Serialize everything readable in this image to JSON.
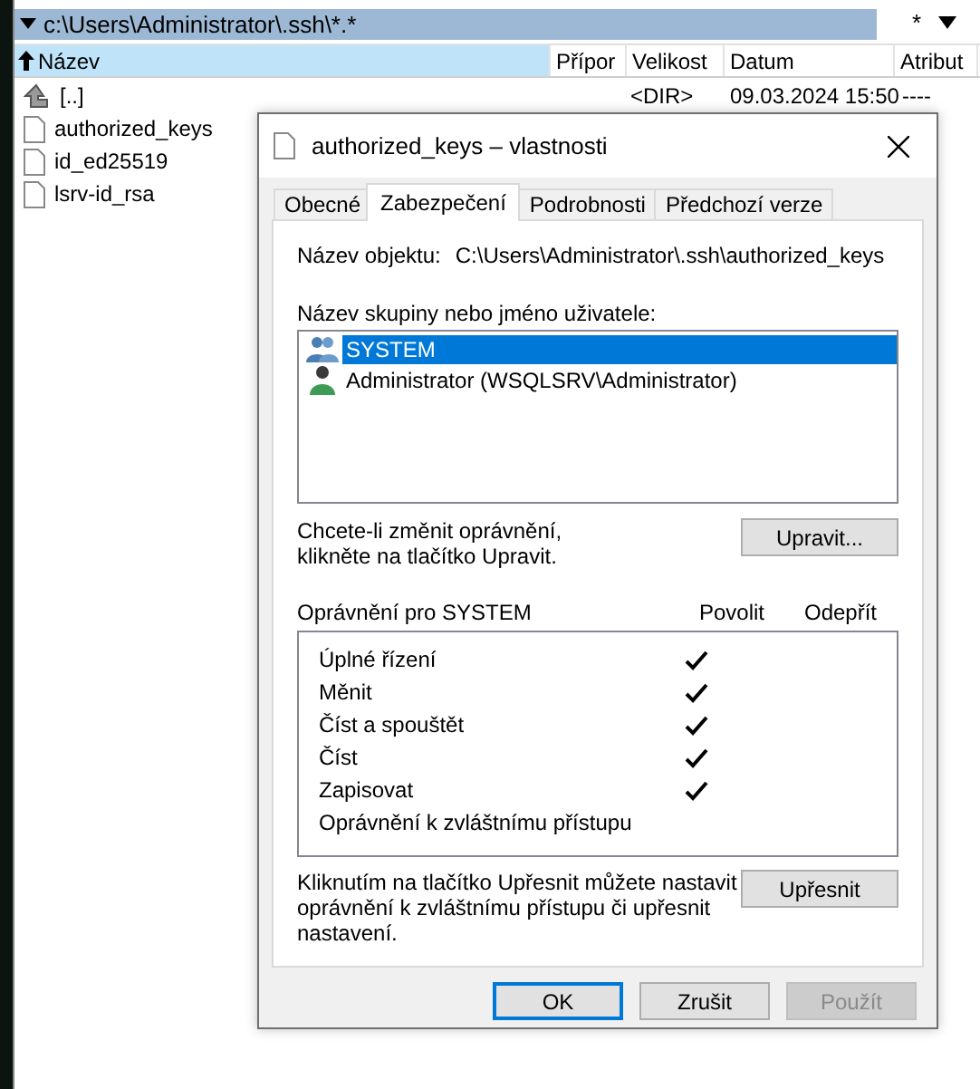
{
  "file_panel": {
    "path": "c:\\Users\\Administrator\\.ssh\\*.*",
    "filter_button": "*",
    "columns": [
      {
        "label": "Název",
        "sorted": true
      },
      {
        "label": "Přípor",
        "sorted": false
      },
      {
        "label": "Velikost",
        "sorted": false
      },
      {
        "label": "Datum",
        "sorted": false
      },
      {
        "label": "Atribut",
        "sorted": false
      }
    ],
    "rows": [
      {
        "kind": "parent",
        "name": "[..]",
        "size": "<DIR>",
        "date": "09.03.2024 15:50",
        "attributes": "----"
      },
      {
        "kind": "file",
        "name": "authorized_keys"
      },
      {
        "kind": "file",
        "name": "id_ed25519"
      },
      {
        "kind": "file",
        "name": "lsrv-id_rsa"
      }
    ]
  },
  "dialog": {
    "title": "authorized_keys – vlastnosti",
    "tabs": [
      {
        "label": "Obecné",
        "selected": false
      },
      {
        "label": "Zabezpečení",
        "selected": true
      },
      {
        "label": "Podrobnosti",
        "selected": false
      },
      {
        "label": "Předchozí verze",
        "selected": false
      }
    ],
    "object_label": "Název objektu:",
    "object_path": "C:\\Users\\Administrator\\.ssh\\authorized_keys",
    "group_label": "Název skupiny nebo jméno uživatele:",
    "principals": [
      {
        "kind": "group",
        "name": "SYSTEM",
        "selected": true
      },
      {
        "kind": "user",
        "name": "Administrator (WSQLSRV\\Administrator)",
        "selected": false
      }
    ],
    "change_hint": "Chcete-li změnit oprávnění,\nklikněte na tlačítko Upravit.",
    "edit_button": "Upravit...",
    "permissions_title": "Oprávnění pro SYSTEM",
    "allow_header": "Povolit",
    "deny_header": "Odepřít",
    "permissions": [
      {
        "name": "Úplné řízení",
        "allow": true,
        "deny": false
      },
      {
        "name": "Měnit",
        "allow": true,
        "deny": false
      },
      {
        "name": "Číst a spouštět",
        "allow": true,
        "deny": false
      },
      {
        "name": "Číst",
        "allow": true,
        "deny": false
      },
      {
        "name": "Zapisovat",
        "allow": true,
        "deny": false
      },
      {
        "name": "Oprávnění k zvláštnímu přístupu",
        "allow": false,
        "deny": false
      }
    ],
    "advanced_hint": "Kliknutím na tlačítko Upřesnit můžete nastavit\noprávnění k zvláštnímu přístupu či upřesnit\nnastavení.",
    "advanced_button": "Upřesnit",
    "buttons": [
      {
        "label": "OK",
        "kind": "default"
      },
      {
        "label": "Zrušit",
        "kind": "normal"
      },
      {
        "label": "Použít",
        "kind": "disabled"
      }
    ]
  }
}
